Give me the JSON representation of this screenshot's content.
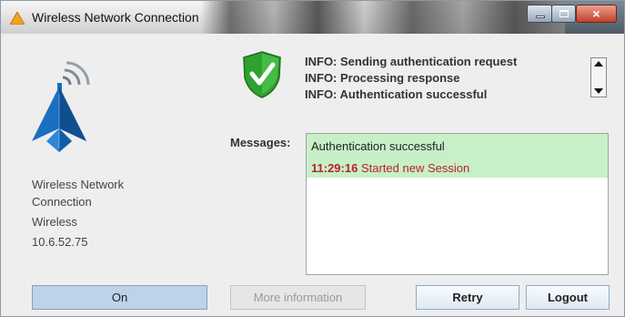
{
  "window": {
    "title": "Wireless Network Connection",
    "close_glyph": "×"
  },
  "connection": {
    "name_line1": "Wireless Network",
    "name_line2": "Connection",
    "type": "Wireless",
    "ip": "10.6.52.75"
  },
  "log_lines": [
    "INFO: Sending authentication request",
    "INFO: Processing response",
    "INFO: Authentication successful"
  ],
  "messages": {
    "label": "Messages:",
    "items": [
      {
        "text": "Authentication successful"
      },
      {
        "time": "11:29:16",
        "text": "Started new Session"
      }
    ]
  },
  "buttons": {
    "on": "On",
    "more_info": "More information",
    "retry": "Retry",
    "logout": "Logout"
  },
  "icons": {
    "app": "warning-triangle-icon",
    "network": "wireless-antenna-icon",
    "status": "green-shield-check-icon"
  },
  "colors": {
    "highlight": "#c8f0c8",
    "session_text": "#b5232b",
    "shield_green": "#2fa12f",
    "antenna_blue": "#1a6fc0"
  }
}
